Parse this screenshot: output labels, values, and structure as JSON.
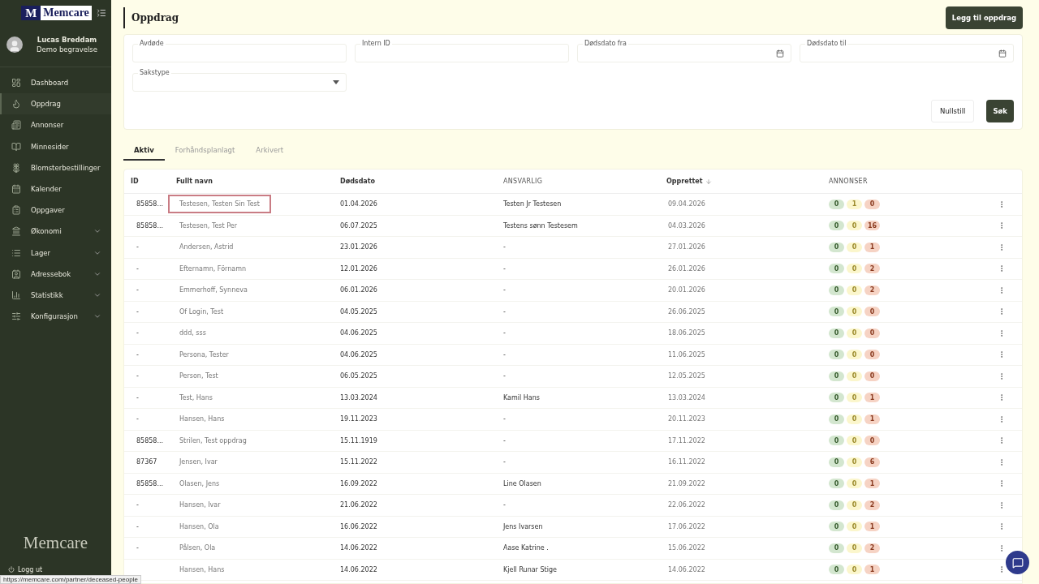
{
  "sidebar": {
    "logo_mark": "M",
    "logo_text": "Memcare",
    "user": {
      "name": "Lucas Breddam",
      "org": "Demo begravelse"
    },
    "items": [
      {
        "label": "Dashboard",
        "selected": false,
        "expandable": false
      },
      {
        "label": "Oppdrag",
        "selected": true,
        "expandable": false
      },
      {
        "label": "Annonser",
        "selected": false,
        "expandable": false
      },
      {
        "label": "Minnesider",
        "selected": false,
        "expandable": false
      },
      {
        "label": "Blomsterbestillinger",
        "selected": false,
        "expandable": false
      },
      {
        "label": "Kalender",
        "selected": false,
        "expandable": false
      },
      {
        "label": "Oppgaver",
        "selected": false,
        "expandable": false
      },
      {
        "label": "Økonomi",
        "selected": false,
        "expandable": true
      },
      {
        "label": "Lager",
        "selected": false,
        "expandable": true
      },
      {
        "label": "Adressebok",
        "selected": false,
        "expandable": true
      },
      {
        "label": "Statistikk",
        "selected": false,
        "expandable": true
      },
      {
        "label": "Konfigurasjon",
        "selected": false,
        "expandable": true
      }
    ],
    "footer_logo": "Memcare",
    "logout": "Logg ut",
    "status_url": "https://memcare.com/partner/deceased-people"
  },
  "page": {
    "title": "Oppdrag",
    "add_button": "Legg til oppdrag"
  },
  "filters": {
    "fields": [
      {
        "label": "Avdøde",
        "kind": "text"
      },
      {
        "label": "Intern ID",
        "kind": "text"
      },
      {
        "label": "Dødsdato fra",
        "kind": "date"
      },
      {
        "label": "Dødsdato til",
        "kind": "date"
      },
      {
        "label": "Sakstype",
        "kind": "select"
      }
    ],
    "reset_button": "Nullstill",
    "search_button": "Søk"
  },
  "tabs": [
    {
      "label": "Aktiv",
      "selected": true
    },
    {
      "label": "Forhåndsplanlagt",
      "selected": false
    },
    {
      "label": "Arkivert",
      "selected": false
    }
  ],
  "table": {
    "columns": [
      "ID",
      "Fullt navn",
      "Dødsdato",
      "ANSVARLIG",
      "Opprettet",
      "ANNONSER"
    ],
    "rows": [
      {
        "id": "85858...",
        "name": "Testesen, Testen Sin Test",
        "death": "01.04.2026",
        "responsible": "Testen Jr Testesen",
        "created": "09.04.2026",
        "counts": [
          "0",
          "1",
          "0"
        ],
        "highlighted": true
      },
      {
        "id": "85858...",
        "name": "Testesen, Test Per",
        "death": "06.07.2025",
        "responsible": "Testens sønn Testesem",
        "created": "04.03.2026",
        "counts": [
          "0",
          "0",
          "16"
        ],
        "highlighted": false
      },
      {
        "id": "-",
        "name": "Andersen, Astrid",
        "death": "23.01.2026",
        "responsible": "-",
        "created": "27.01.2026",
        "counts": [
          "0",
          "0",
          "1"
        ],
        "highlighted": false
      },
      {
        "id": "-",
        "name": "Efternamn, Förnamn",
        "death": "12.01.2026",
        "responsible": "-",
        "created": "26.01.2026",
        "counts": [
          "0",
          "0",
          "2"
        ],
        "highlighted": false
      },
      {
        "id": "-",
        "name": "Emmerhoff, Synneva",
        "death": "06.01.2026",
        "responsible": "-",
        "created": "20.01.2026",
        "counts": [
          "0",
          "0",
          "2"
        ],
        "highlighted": false
      },
      {
        "id": "-",
        "name": "Of Login, Test",
        "death": "04.05.2025",
        "responsible": "-",
        "created": "26.06.2025",
        "counts": [
          "0",
          "0",
          "0"
        ],
        "highlighted": false
      },
      {
        "id": "-",
        "name": "ddd, sss",
        "death": "04.06.2025",
        "responsible": "-",
        "created": "18.06.2025",
        "counts": [
          "0",
          "0",
          "0"
        ],
        "highlighted": false
      },
      {
        "id": "-",
        "name": "Persona, Tester",
        "death": "04.06.2025",
        "responsible": "-",
        "created": "11.06.2025",
        "counts": [
          "0",
          "0",
          "0"
        ],
        "highlighted": false
      },
      {
        "id": "-",
        "name": "Person, Test",
        "death": "06.05.2025",
        "responsible": "-",
        "created": "12.05.2025",
        "counts": [
          "0",
          "0",
          "0"
        ],
        "highlighted": false
      },
      {
        "id": "-",
        "name": "Test, Hans",
        "death": "13.03.2024",
        "responsible": "Kamil Hans",
        "created": "13.03.2024",
        "counts": [
          "0",
          "0",
          "1"
        ],
        "highlighted": false
      },
      {
        "id": "-",
        "name": "Hansen, Hans",
        "death": "19.11.2023",
        "responsible": "-",
        "created": "20.11.2023",
        "counts": [
          "0",
          "0",
          "1"
        ],
        "highlighted": false
      },
      {
        "id": "85858...",
        "name": "Strilen, Test oppdrag",
        "death": "15.11.1919",
        "responsible": "-",
        "created": "17.11.2022",
        "counts": [
          "0",
          "0",
          "0"
        ],
        "highlighted": false
      },
      {
        "id": "87367",
        "name": "Jensen, Ivar",
        "death": "15.11.2022",
        "responsible": "-",
        "created": "16.11.2022",
        "counts": [
          "0",
          "0",
          "6"
        ],
        "highlighted": false
      },
      {
        "id": "85858...",
        "name": "Olasen, Jens",
        "death": "16.09.2022",
        "responsible": "Line Olasen",
        "created": "21.09.2022",
        "counts": [
          "0",
          "0",
          "1"
        ],
        "highlighted": false
      },
      {
        "id": "-",
        "name": "Hansen, Ivar",
        "death": "21.06.2022",
        "responsible": "-",
        "created": "22.06.2022",
        "counts": [
          "0",
          "0",
          "2"
        ],
        "highlighted": false
      },
      {
        "id": "-",
        "name": "Hansen, Ola",
        "death": "16.06.2022",
        "responsible": "Jens Ivarsen",
        "created": "17.06.2022",
        "counts": [
          "0",
          "0",
          "1"
        ],
        "highlighted": false
      },
      {
        "id": "-",
        "name": "Pålsen, Ola",
        "death": "14.06.2022",
        "responsible": "Aase Katrine .",
        "created": "15.06.2022",
        "counts": [
          "0",
          "0",
          "2"
        ],
        "highlighted": false
      },
      {
        "name": "Hansen, Hans",
        "death": "14.06.2022",
        "responsible": "Kjell Runar Stige",
        "created": "14.06.2022",
        "counts": [
          "0",
          "0",
          "1"
        ],
        "highlighted": false
      }
    ]
  }
}
